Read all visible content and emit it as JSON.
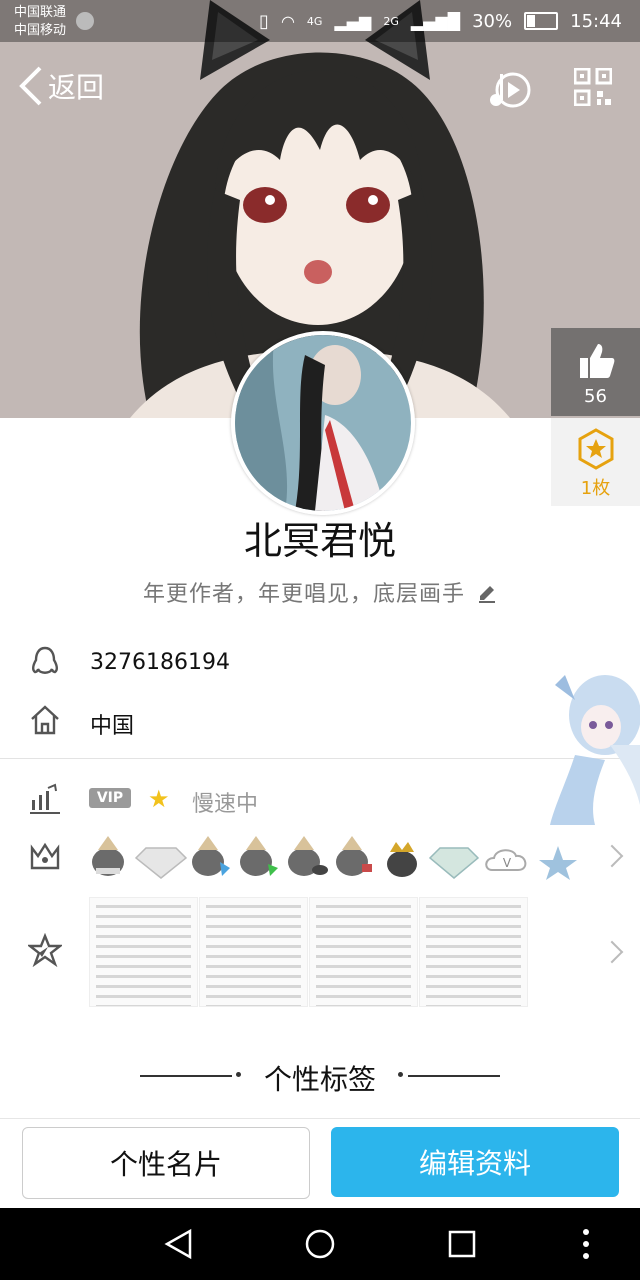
{
  "status_bar": {
    "carrier1": "中国联通",
    "carrier2": "中国移动",
    "network1": "4G",
    "network2": "2G",
    "battery": "30%",
    "time": "15:44"
  },
  "nav": {
    "back_label": "返回"
  },
  "likes": {
    "count": "56",
    "badge_count": "1枚"
  },
  "profile": {
    "nickname": "北冥君悦",
    "signature": "年更作者，年更唱见，底层画手",
    "qq_number": "3276186194",
    "location": "中国"
  },
  "vip": {
    "label": "VIP",
    "status": "慢速中"
  },
  "medals": [
    "penguin-gold",
    "diamond",
    "penguin-blue",
    "penguin-green",
    "penguin-bird",
    "penguin-red",
    "penguin-crown",
    "diamond-green",
    "cloud-v",
    "star-blue"
  ],
  "section": {
    "tag_title": "个性标签"
  },
  "buttons": {
    "card": "个性名片",
    "edit": "编辑资料"
  },
  "colors": {
    "accent": "#2cb5ec",
    "badge": "#e6a20f",
    "text_dark": "#111111",
    "text_gray": "#777777"
  }
}
